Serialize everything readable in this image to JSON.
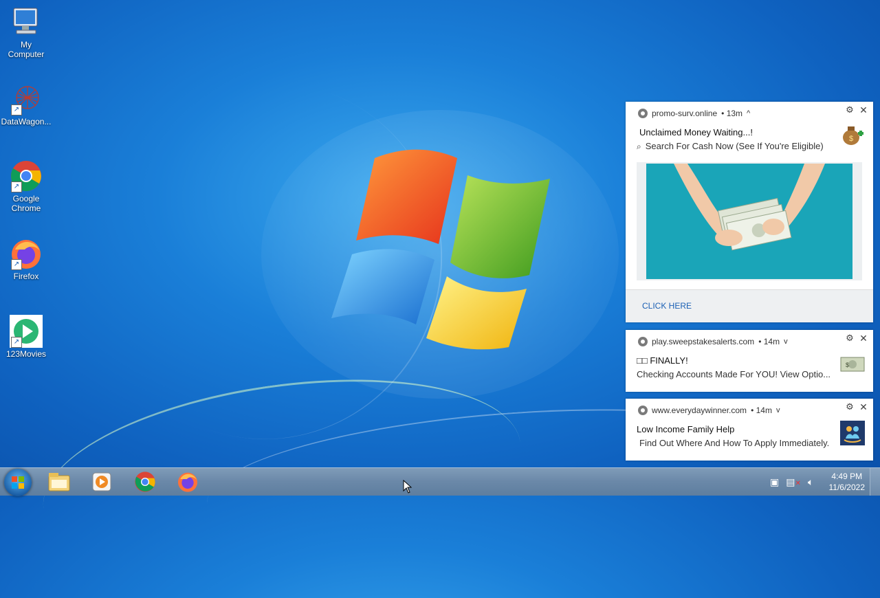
{
  "desktop": {
    "icons": [
      {
        "label": "My\nComputer",
        "icon": "computer-icon"
      },
      {
        "label": "DataWagon...",
        "icon": "datawagon-icon"
      },
      {
        "label": "Google\nChrome",
        "icon": "chrome-icon"
      },
      {
        "label": "Firefox",
        "icon": "firefox-icon"
      },
      {
        "label": "123Movies",
        "icon": "123movies-icon"
      }
    ]
  },
  "notifications": [
    {
      "site": "promo-surv.online",
      "age": "• 13m",
      "chevron": "^",
      "title": "Unclaimed Money Waiting...!",
      "body": "Search For Cash Now (See If You're Eligible)",
      "action": "CLICK HERE",
      "thumb": "money-bag-icon"
    },
    {
      "site": "play.sweepstakesalerts.com",
      "age": "• 14m",
      "chevron": "v",
      "title": "□□ FINALLY!",
      "body": "Checking Accounts Made For YOU! View Optio...",
      "thumb": "dollar-bill-icon"
    },
    {
      "site": "www.everydaywinner.com",
      "age": "• 14m",
      "chevron": "v",
      "title": "Low Income Family Help",
      "body": "Find Out Where And How To Apply Immediately.",
      "thumb": "family-icon"
    }
  ],
  "taskbar": {
    "pinned": [
      "explorer-icon",
      "media-player-icon",
      "chrome-icon",
      "firefox-icon"
    ],
    "time": "4:49 PM",
    "date": "11/6/2022"
  },
  "colors": {
    "desktop_bg": "#1a7fd8",
    "link": "#1a5fb4",
    "taskbar": "#6a88a8"
  }
}
